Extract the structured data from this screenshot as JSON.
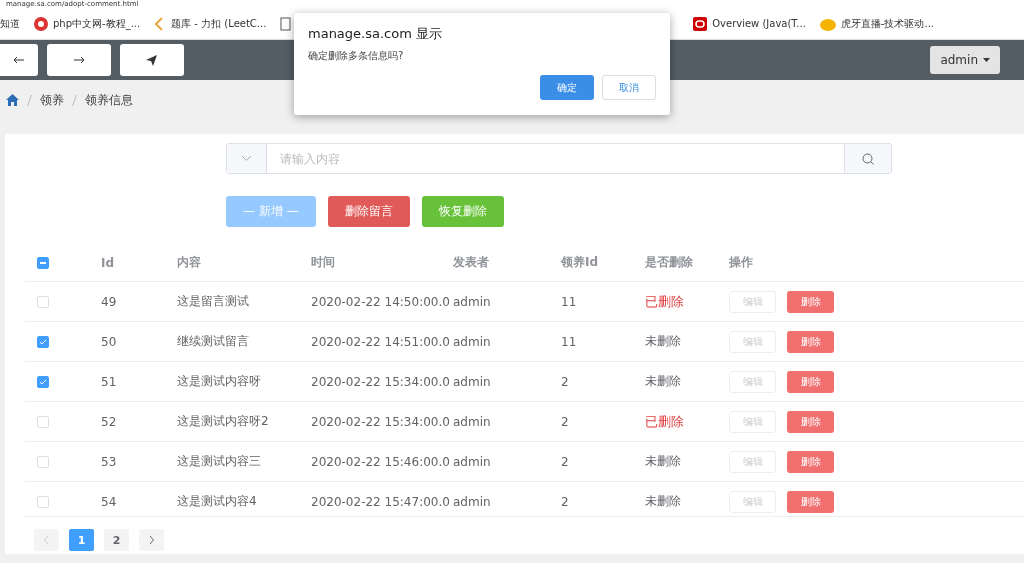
{
  "address_bar": {
    "url": "manage.sa.com/adopt-comment.html"
  },
  "bookmarks": [
    {
      "label": "知道",
      "kind": "none"
    },
    {
      "label": "php中文网-教程_...",
      "kind": "php"
    },
    {
      "label": "题库 - 力扣 (LeetC...",
      "kind": "leetcode"
    },
    {
      "kind": "page"
    },
    {
      "label": "Overview (Java(T...",
      "kind": "oracle"
    },
    {
      "label": "虎牙直播-技术驱动...",
      "kind": "huya"
    }
  ],
  "toolbar": {
    "buttons": [
      {
        "kind": "back"
      },
      {
        "kind": "forward"
      },
      {
        "kind": "send"
      }
    ],
    "user_menu": "admin"
  },
  "breadcrumb": [
    "领养",
    "领养信息"
  ],
  "search": {
    "placeholder": "请输入内容"
  },
  "actions": [
    {
      "label": "— 新增 —",
      "kind": "primary",
      "disabled": true
    },
    {
      "label": "删除留言",
      "kind": "danger",
      "disabled": false
    },
    {
      "label": "恢复删除",
      "kind": "success",
      "disabled": false
    }
  ],
  "table": {
    "select_all": {
      "kind": "indeterminate"
    },
    "columns": [
      "Id",
      "内容",
      "时间",
      "发表者",
      "领养Id",
      "是否删除",
      "操作"
    ],
    "rows": [
      {
        "checked": false,
        "id": "49",
        "content": "这是留言测试",
        "time": "2020-02-22 14:50:00.0",
        "author": "admin",
        "adopt_id": "11",
        "status": "已删除",
        "deleted": true,
        "edit": "编辑",
        "delete": "删除"
      },
      {
        "checked": true,
        "id": "50",
        "content": "继续测试留言",
        "time": "2020-02-22 14:51:00.0",
        "author": "admin",
        "adopt_id": "11",
        "status": "未删除",
        "deleted": false,
        "edit": "编辑",
        "delete": "删除"
      },
      {
        "checked": true,
        "id": "51",
        "content": "这是测试内容呀",
        "time": "2020-02-22 15:34:00.0",
        "author": "admin",
        "adopt_id": "2",
        "status": "未删除",
        "deleted": false,
        "edit": "编辑",
        "delete": "删除"
      },
      {
        "checked": false,
        "id": "52",
        "content": "这是测试内容呀2",
        "time": "2020-02-22 15:34:00.0",
        "author": "admin",
        "adopt_id": "2",
        "status": "已删除",
        "deleted": true,
        "edit": "编辑",
        "delete": "删除"
      },
      {
        "checked": false,
        "id": "53",
        "content": "这是测试内容三",
        "time": "2020-02-22 15:46:00.0",
        "author": "admin",
        "adopt_id": "2",
        "status": "未删除",
        "deleted": false,
        "edit": "编辑",
        "delete": "删除"
      },
      {
        "checked": false,
        "id": "54",
        "content": "这是测试内容4",
        "time": "2020-02-22 15:47:00.0",
        "author": "admin",
        "adopt_id": "2",
        "status": "未删除",
        "deleted": false,
        "edit": "编辑",
        "delete": "删除"
      }
    ]
  },
  "pagination": {
    "pages": [
      {
        "label": "1",
        "selected": true
      },
      {
        "label": "2",
        "selected": false
      }
    ]
  },
  "dialog": {
    "title": "manage.sa.com 显示",
    "message": "确定删除多条信息吗?",
    "buttons": [
      {
        "label": "确定",
        "kind": "primary"
      },
      {
        "label": "取消",
        "kind": "default"
      }
    ]
  }
}
